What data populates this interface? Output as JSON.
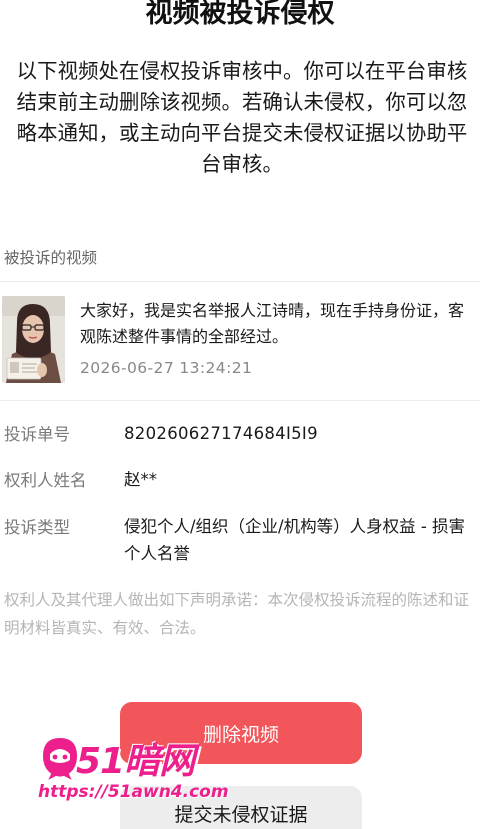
{
  "header": {
    "title": "视频被投诉侵权"
  },
  "intro": "以下视频处在侵权投诉审核中。你可以在平台审核结束前主动删除该视频。若确认未侵权，你可以忽略本通知，或主动向平台提交未侵权证据以协助平台审核。",
  "video_section": {
    "label": "被投诉的视频",
    "description": "大家好，我是实名举报人江诗晴，现在手持身份证，客观陈述整件事情的全部经过。",
    "time": "2026-06-27 13:24:21"
  },
  "details": {
    "complaint_no": {
      "label": "投诉单号",
      "value": "820260627174684I5I9"
    },
    "owner_name": {
      "label": "权利人姓名",
      "value": "赵**"
    },
    "complaint_type": {
      "label": "投诉类型",
      "value": "侵犯个人/组织（企业/机构等）人身权益 - 损害个人名誉"
    }
  },
  "declaration": "权利人及其代理人做出如下声明承诺：本次侵权投诉流程的陈述和证明材料皆真实、有效、合法。",
  "actions": {
    "delete_label": "删除视频",
    "submit_label": "提交未侵权证据"
  },
  "watermark": {
    "brand": "51暗网",
    "url": "https://51awn4.com"
  },
  "colors": {
    "primary": "#f2565a",
    "watermark": "#ec1f8c",
    "secondary_button": "#ededed"
  }
}
